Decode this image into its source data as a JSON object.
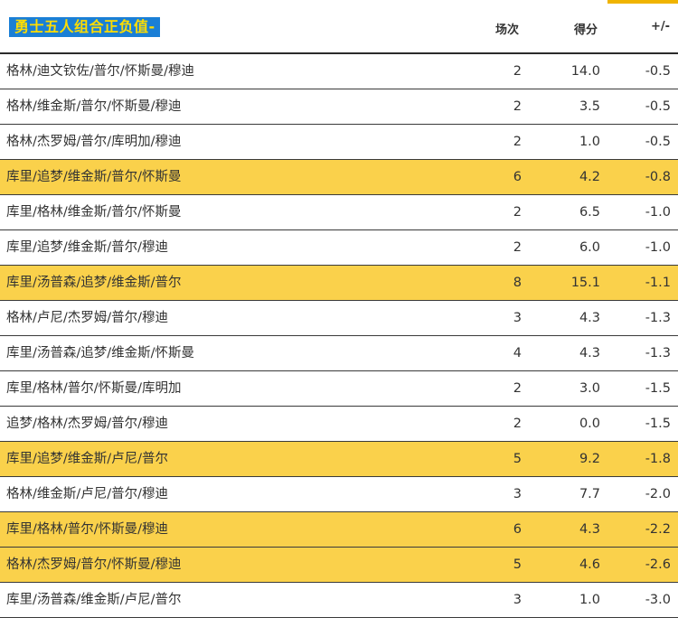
{
  "title": "勇士五人组合正负值-",
  "columns": {
    "games": "场次",
    "points": "得分",
    "plus_minus": "+/-"
  },
  "colors": {
    "title_bg": "#1a7fd6",
    "title_text": "#ffdd00",
    "highlight": "#fad14b",
    "accent": "#f0b400"
  },
  "rows": [
    {
      "lineup": "格林/迪文钦佐/普尔/怀斯曼/穆迪",
      "games": "2",
      "points": "14.0",
      "pm": "-0.5",
      "highlight": false
    },
    {
      "lineup": "格林/维金斯/普尔/怀斯曼/穆迪",
      "games": "2",
      "points": "3.5",
      "pm": "-0.5",
      "highlight": false
    },
    {
      "lineup": "格林/杰罗姆/普尔/库明加/穆迪",
      "games": "2",
      "points": "1.0",
      "pm": "-0.5",
      "highlight": false
    },
    {
      "lineup": "库里/追梦/维金斯/普尔/怀斯曼",
      "games": "6",
      "points": "4.2",
      "pm": "-0.8",
      "highlight": true
    },
    {
      "lineup": "库里/格林/维金斯/普尔/怀斯曼",
      "games": "2",
      "points": "6.5",
      "pm": "-1.0",
      "highlight": false
    },
    {
      "lineup": "库里/追梦/维金斯/普尔/穆迪",
      "games": "2",
      "points": "6.0",
      "pm": "-1.0",
      "highlight": false
    },
    {
      "lineup": "库里/汤普森/追梦/维金斯/普尔",
      "games": "8",
      "points": "15.1",
      "pm": "-1.1",
      "highlight": true
    },
    {
      "lineup": "格林/卢尼/杰罗姆/普尔/穆迪",
      "games": "3",
      "points": "4.3",
      "pm": "-1.3",
      "highlight": false
    },
    {
      "lineup": "库里/汤普森/追梦/维金斯/怀斯曼",
      "games": "4",
      "points": "4.3",
      "pm": "-1.3",
      "highlight": false
    },
    {
      "lineup": "库里/格林/普尔/怀斯曼/库明加",
      "games": "2",
      "points": "3.0",
      "pm": "-1.5",
      "highlight": false
    },
    {
      "lineup": "追梦/格林/杰罗姆/普尔/穆迪",
      "games": "2",
      "points": "0.0",
      "pm": "-1.5",
      "highlight": false
    },
    {
      "lineup": "库里/追梦/维金斯/卢尼/普尔",
      "games": "5",
      "points": "9.2",
      "pm": "-1.8",
      "highlight": true
    },
    {
      "lineup": "格林/维金斯/卢尼/普尔/穆迪",
      "games": "3",
      "points": "7.7",
      "pm": "-2.0",
      "highlight": false
    },
    {
      "lineup": "库里/格林/普尔/怀斯曼/穆迪",
      "games": "6",
      "points": "4.3",
      "pm": "-2.2",
      "highlight": true
    },
    {
      "lineup": "格林/杰罗姆/普尔/怀斯曼/穆迪",
      "games": "5",
      "points": "4.6",
      "pm": "-2.6",
      "highlight": true
    },
    {
      "lineup": "库里/汤普森/维金斯/卢尼/普尔",
      "games": "3",
      "points": "1.0",
      "pm": "-3.0",
      "highlight": false
    }
  ]
}
